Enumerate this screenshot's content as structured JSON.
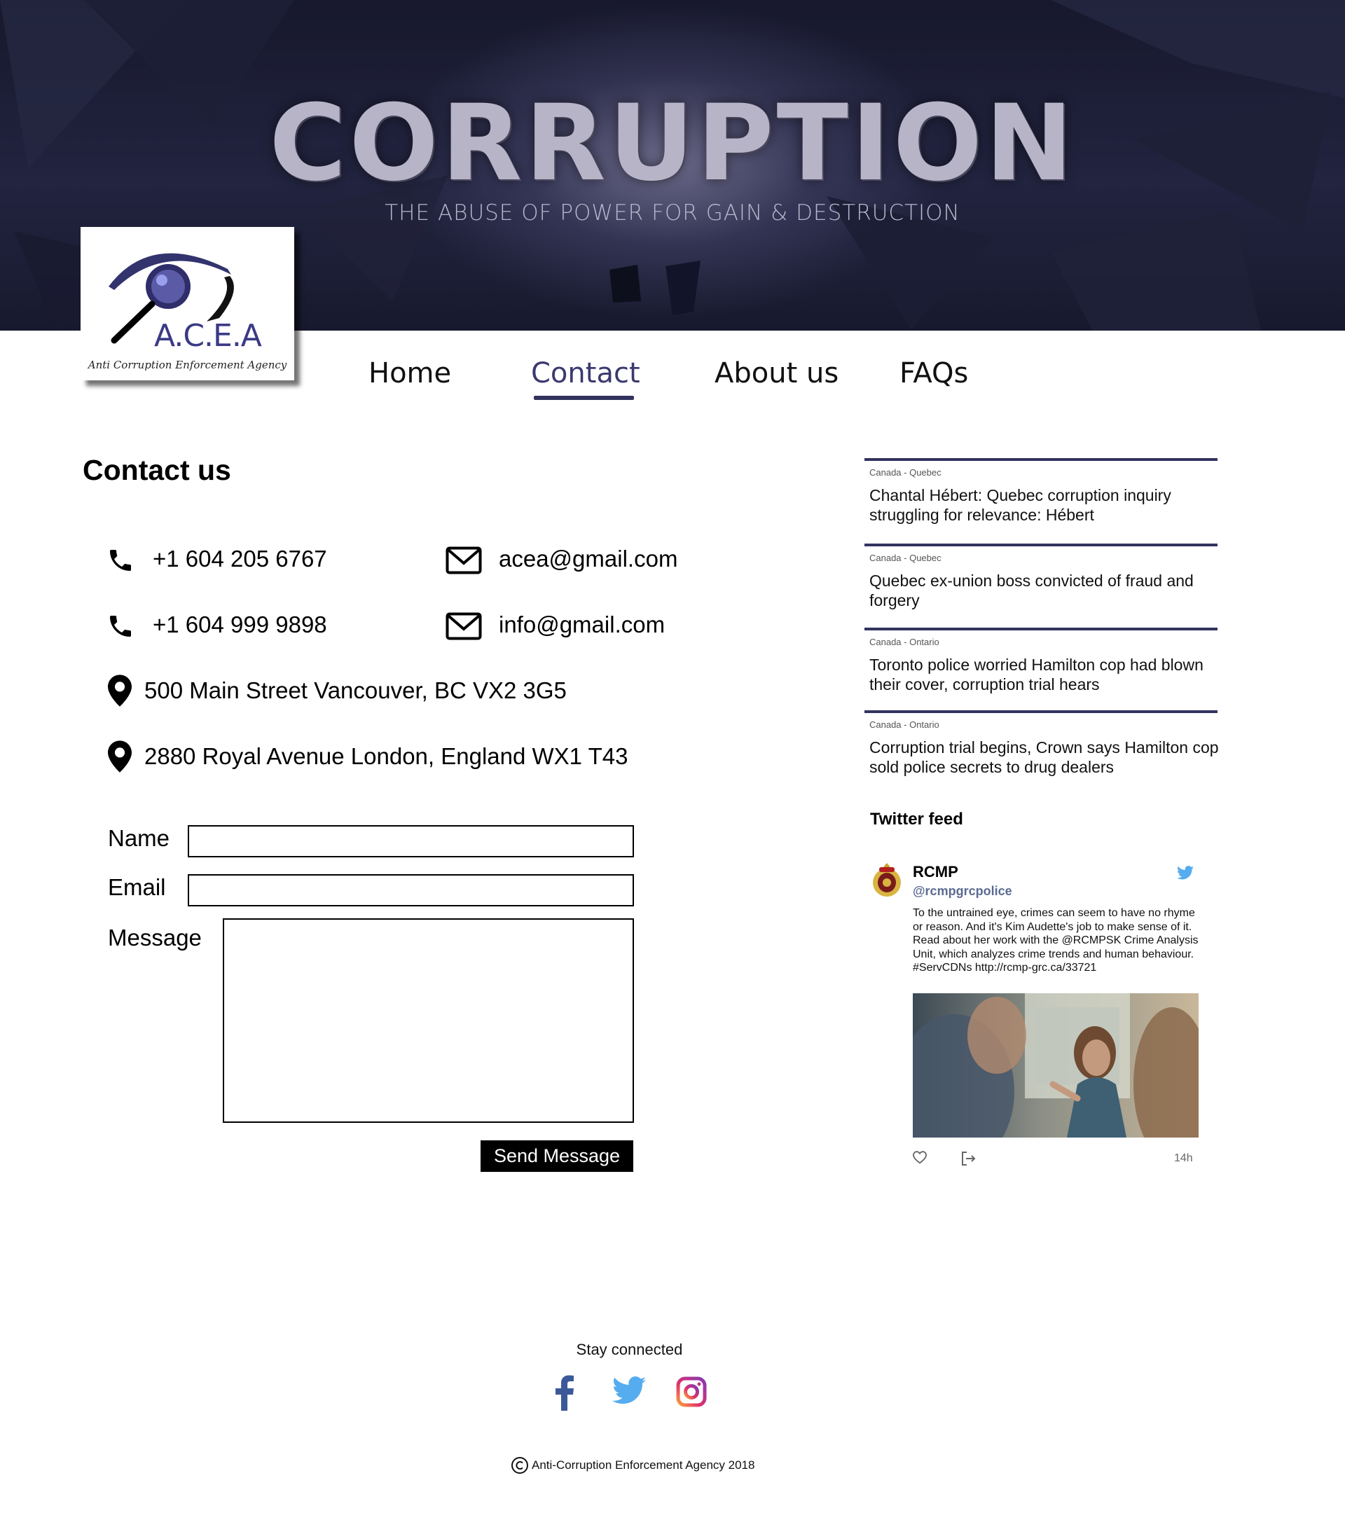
{
  "hero": {
    "title": "CORRUPTION",
    "subtitle": "THE ABUSE OF POWER FOR GAIN & DESTRUCTION"
  },
  "logo": {
    "acronym": "A.C.E.A",
    "tagline": "Anti Corruption Enforcement Agency",
    "icon": "magnifier-eye-icon",
    "color": "#3b3a86"
  },
  "nav": {
    "items": [
      {
        "label": "Home"
      },
      {
        "label": "Contact",
        "active": true
      },
      {
        "label": "About us"
      },
      {
        "label": "FAQs"
      }
    ],
    "active_color": "#33335f"
  },
  "contact": {
    "title": "Contact us",
    "phones": [
      "+1 604 205 6767",
      "+1 604 999 9898"
    ],
    "emails": [
      "acea@gmail.com",
      "info@gmail.com"
    ],
    "addresses": [
      "500 Main Street Vancouver, BC VX2 3G5",
      "2880 Royal Avenue London, England WX1 T43"
    ],
    "icons": {
      "phone": "phone-icon",
      "email": "envelope-icon",
      "address": "map-pin-icon"
    }
  },
  "form": {
    "name_label": "Name",
    "email_label": "Email",
    "message_label": "Message",
    "name_value": "",
    "email_value": "",
    "message_value": "",
    "submit_label": "Send Message"
  },
  "news": [
    {
      "category": "Canada - Quebec",
      "headline": "Chantal Hébert: Quebec corruption inquiry struggling for relevance: Hébert"
    },
    {
      "category": "Canada - Quebec",
      "headline": "Quebec ex-union boss convicted of fraud and forgery"
    },
    {
      "category": "Canada - Ontario",
      "headline": "Toronto police worried Hamilton cop had blown their cover, corruption trial hears"
    },
    {
      "category": "Canada - Ontario",
      "headline": "Corruption trial begins, Crown says Hamilton cop sold police secrets to drug dealers"
    }
  ],
  "twitter": {
    "title": "Twitter feed",
    "tweet": {
      "name": "RCMP",
      "handle": "@rcmpgrcpolice",
      "text": "To the untrained eye, crimes can seem to have no rhyme or reason. And it's Kim Audette's job to make sense of it. Read about her work with the @RCMPSK Crime Analysis Unit, which analyzes crime trends and human behaviour. #ServCDNs http://rcmp-grc.ca/33721",
      "time": "14h",
      "avatar_icon": "rcmp-crest-icon",
      "brand_icon": "twitter-bird-icon",
      "photo": "photo-analyst-presenting"
    },
    "accent": "#55acee"
  },
  "footer": {
    "stay_connected": "Stay connected",
    "social": [
      {
        "name": "facebook",
        "icon": "facebook-icon",
        "color": "#3b5998"
      },
      {
        "name": "twitter",
        "icon": "twitter-icon",
        "color": "#55acee"
      },
      {
        "name": "instagram",
        "icon": "instagram-icon",
        "color": "#c13584"
      }
    ],
    "copyright": "Anti-Corruption Enforcement Agency 2018"
  }
}
